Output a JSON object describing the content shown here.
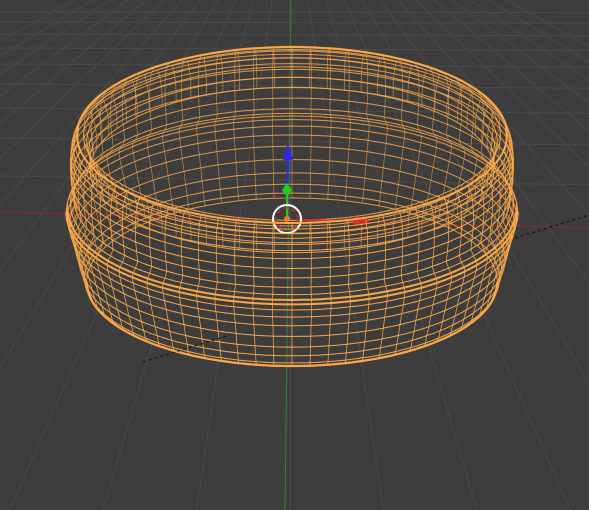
{
  "viewport": {
    "view": "3d-viewport",
    "background_color": "#3d3d3d",
    "grid_color": "#4a4a4a",
    "axis_x_color": "#8a2a2a",
    "axis_y_color": "#3a7a3a",
    "selection_color": "#f7a64a",
    "selected_object": "ring-mesh",
    "display_mode": "wireframe",
    "gizmo": {
      "type": "translate",
      "x_handle_color": "#dd2a2a",
      "y_handle_color": "#22cc22",
      "z_handle_color": "#2a2aee",
      "pivot_icon": "3d-cursor-icon"
    }
  }
}
